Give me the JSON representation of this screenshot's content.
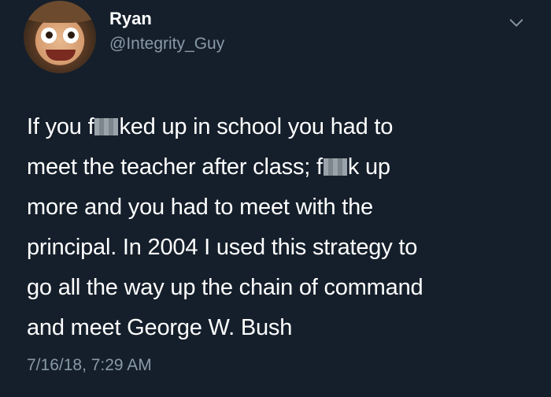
{
  "user": {
    "display_name": "Ryan",
    "handle": "@Integrity_Guy"
  },
  "tweet": {
    "line1_a": "If you f",
    "line1_b": "ked up in school you had to",
    "line2_a": "meet the teacher after class; f",
    "line2_b": "k up",
    "line3": "more and you had to meet with the",
    "line4": "principal. In 2004 I used this strategy to",
    "line5": "go all the way up the chain of command",
    "line6": "and meet George W. Bush",
    "timestamp": "7/16/18, 7:29 AM"
  },
  "icons": {
    "menu": "chevron-down-icon",
    "censor": "censor-block"
  },
  "colors": {
    "background": "#151f2b",
    "text": "#ffffff",
    "secondary_text": "#8899a6"
  }
}
